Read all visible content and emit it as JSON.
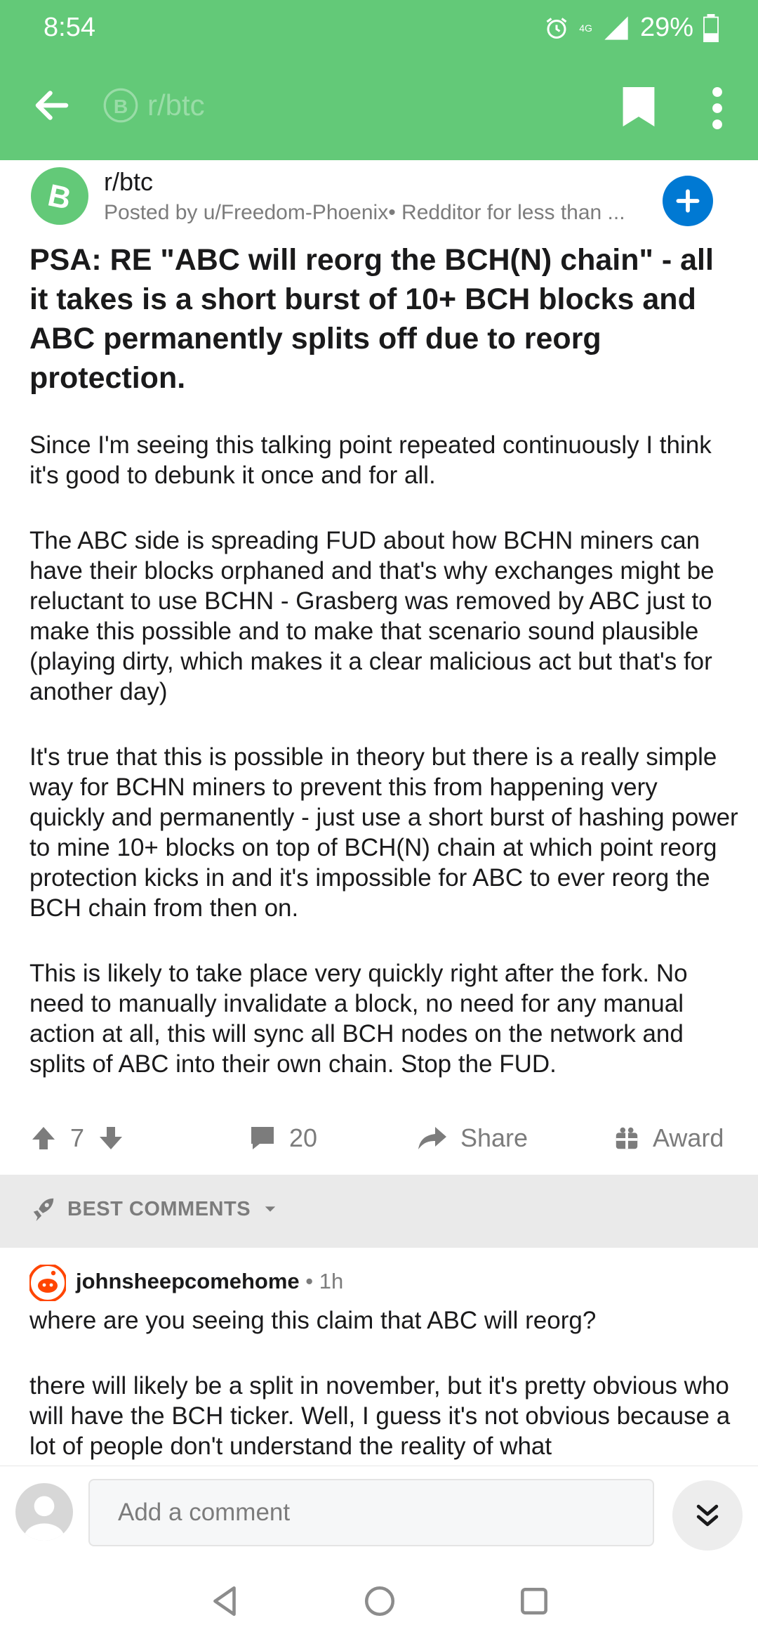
{
  "status": {
    "time": "8:54",
    "network": "4G",
    "battery": "29%"
  },
  "toolbar": {
    "subreddit": "r/btc",
    "back_icon": "arrow-left-icon",
    "save_icon": "bookmark-icon",
    "more_icon": "more-vertical-icon"
  },
  "post": {
    "subreddit": "r/btc",
    "posted_by": "Posted by u/Freedom-Phoenix• Redditor for less than ...",
    "title": "PSA: RE \"ABC will reorg the BCH(N) chain\" - all it takes is a short burst of 10+ BCH blocks and ABC permanently splits off due to reorg protection.",
    "body": [
      "Since I'm seeing this talking point repeated continuously I think it's good to debunk it once and for all.",
      "The ABC side is spreading FUD about how BCHN miners can have their blocks orphaned and that's why exchanges might be reluctant to use BCHN - Grasberg was removed by ABC just to make this possible and to make that scenario sound plausible (playing dirty, which makes it a clear malicious act but that's for another day)",
      "It's true that this is possible in theory but there is a really simple way for BCHN miners to prevent this from happening very quickly and permanently - just use a short burst of hashing power to mine 10+ blocks on top of BCH(N) chain at which point reorg protection kicks in and it's impossible for ABC to ever reorg the BCH chain from then on.",
      "This is likely to take place very quickly right after the fork. No need to manually invalidate a block, no need for any manual action at all, this will sync all BCH nodes on the network and splits of ABC into their own chain. Stop the FUD."
    ],
    "votes": "7",
    "comments": "20",
    "share_label": "Share",
    "award_label": "Award"
  },
  "sort": {
    "label": "BEST COMMENTS"
  },
  "comment": {
    "author": "johnsheepcomehome",
    "time": " • 1h",
    "body": [
      "where are you seeing this claim that ABC will reorg?",
      "there will likely be a split in november, but it's pretty obvious who will have the BCH ticker. Well, I guess it's not obvious because a lot of people don't understand the reality of what"
    ]
  },
  "composer": {
    "placeholder": "Add a comment"
  },
  "colors": {
    "appbar": "#63c978",
    "join": "#0079d3",
    "muted": "#7c7c7c"
  }
}
